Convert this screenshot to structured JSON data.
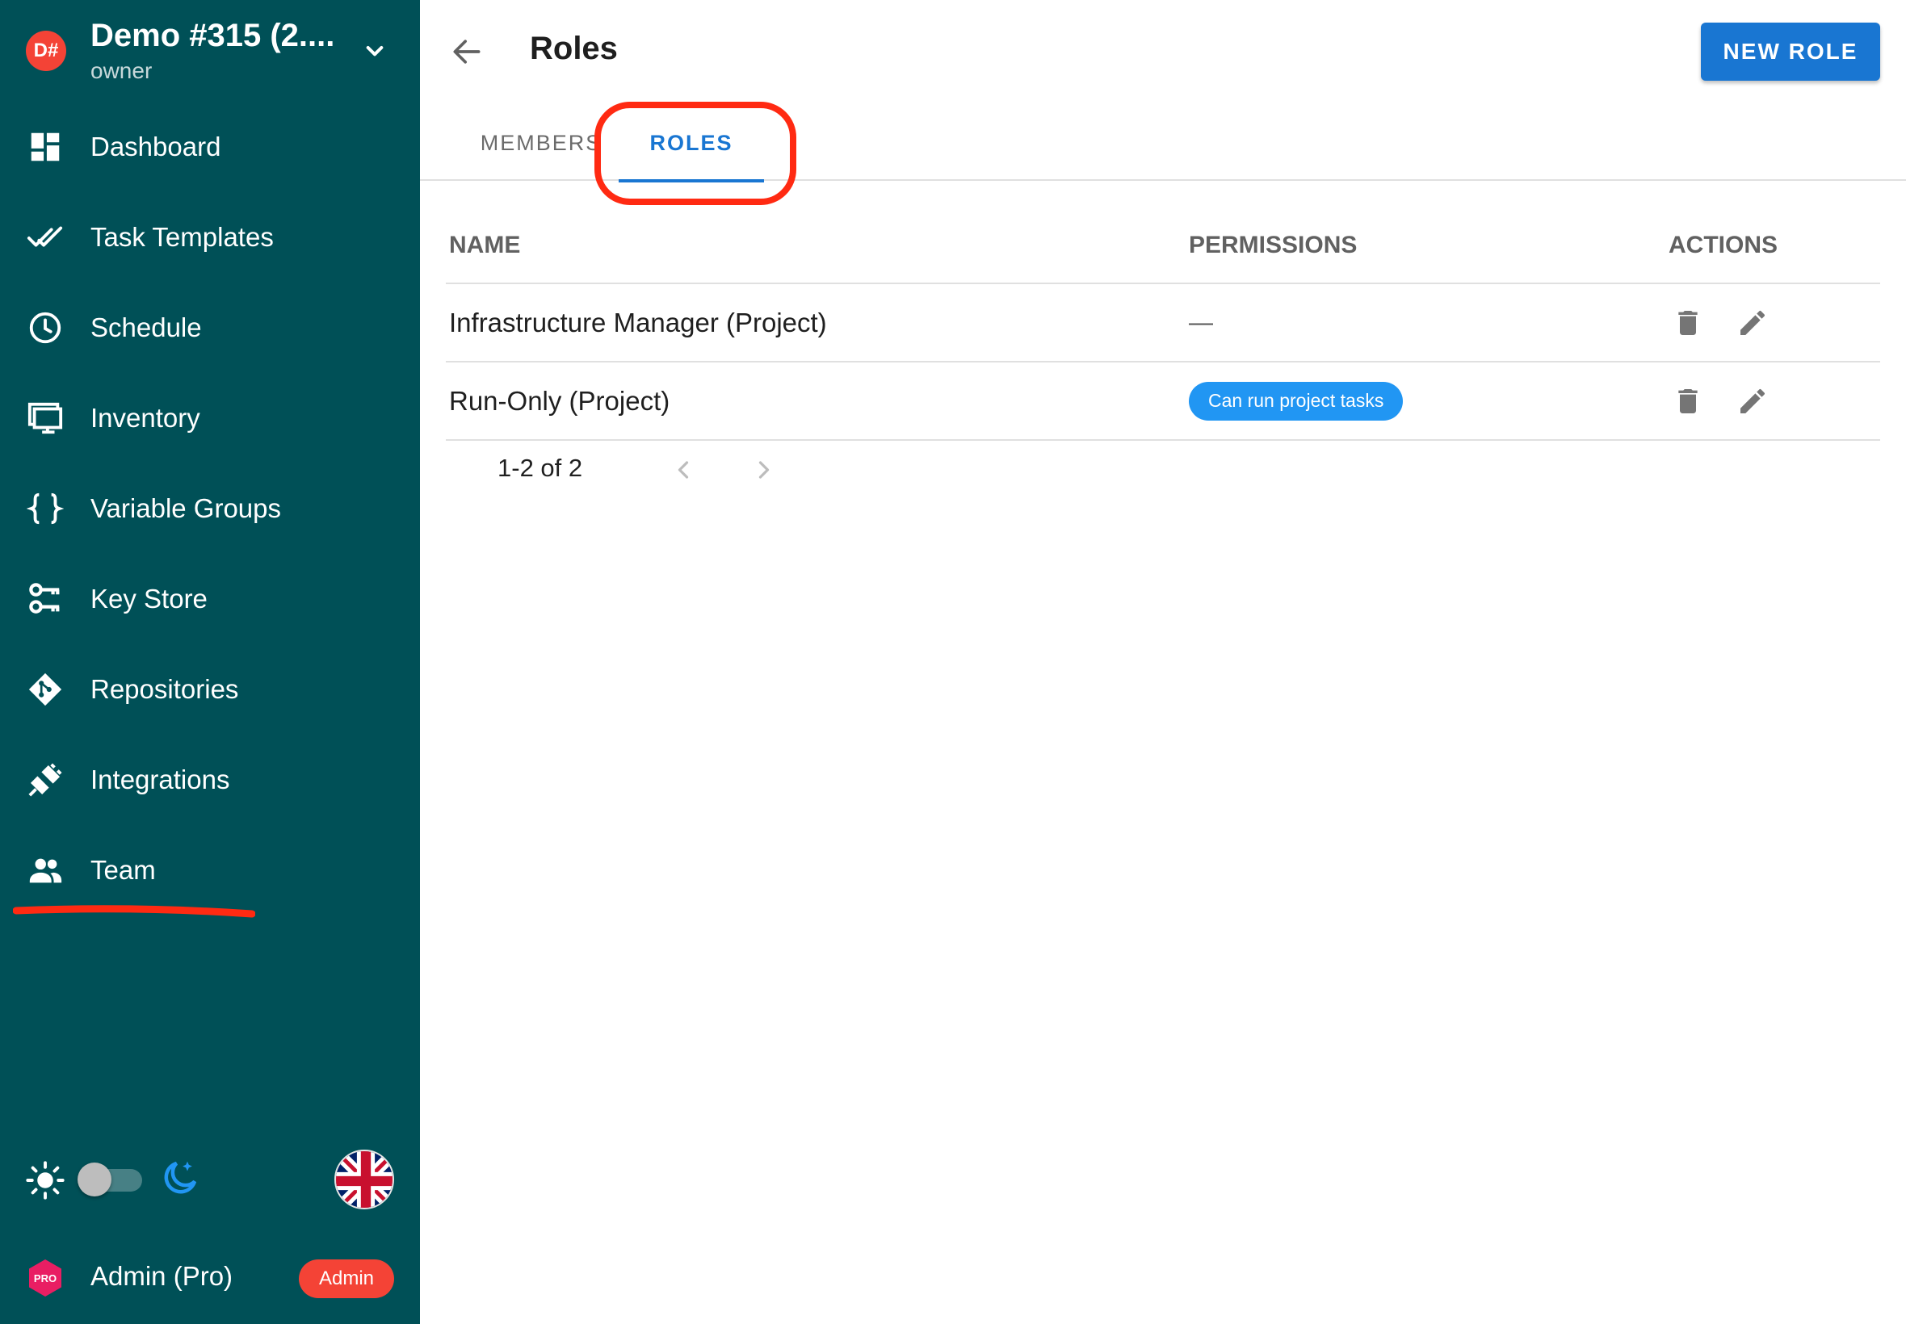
{
  "project": {
    "avatar_text": "D#",
    "name": "Demo #315 (2....",
    "role": "owner"
  },
  "nav": {
    "items": [
      {
        "label": "Dashboard",
        "icon": "dashboard-icon"
      },
      {
        "label": "Task Templates",
        "icon": "done-all-icon"
      },
      {
        "label": "Schedule",
        "icon": "clock-icon"
      },
      {
        "label": "Inventory",
        "icon": "monitor-icon"
      },
      {
        "label": "Variable Groups",
        "icon": "code-braces-icon"
      },
      {
        "label": "Key Store",
        "icon": "key-icon"
      },
      {
        "label": "Repositories",
        "icon": "git-icon"
      },
      {
        "label": "Integrations",
        "icon": "plug-icon"
      },
      {
        "label": "Team",
        "icon": "team-icon"
      }
    ],
    "active": "Team"
  },
  "theme": {
    "dark_mode": false
  },
  "user": {
    "name": "Admin (Pro)",
    "pro_badge": "PRO",
    "admin_chip": "Admin"
  },
  "header": {
    "title": "Roles",
    "new_role_label": "NEW ROLE"
  },
  "tabs": {
    "members": "MEMBERS",
    "roles": "ROLES",
    "active": "roles"
  },
  "table": {
    "headers": {
      "name": "NAME",
      "permissions": "PERMISSIONS",
      "actions": "ACTIONS"
    },
    "rows": [
      {
        "name": "Infrastructure Manager (Project)",
        "permissions": "—"
      },
      {
        "name": "Run-Only (Project)",
        "permissions": "Can run project tasks"
      }
    ]
  },
  "pagination": {
    "text": "1-2 of 2"
  },
  "colors": {
    "sidebar": "#005057",
    "primary": "#1976d2",
    "chip": "#2196f3",
    "danger": "#f44336",
    "annotation": "#ff2a12"
  }
}
